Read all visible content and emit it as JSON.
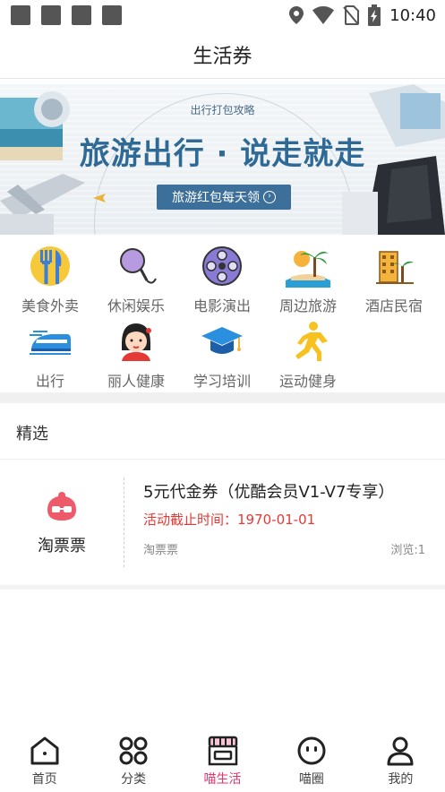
{
  "status_bar": {
    "time": "10:40",
    "icons": [
      "notification-square-icon",
      "notification-square-icon",
      "notification-square-icon",
      "notification-square-icon",
      "location-icon",
      "wifi-icon",
      "no-sim-icon",
      "battery-charging-icon"
    ]
  },
  "header": {
    "title": "生活券"
  },
  "banner": {
    "subtitle": "出行打包攻略",
    "title": "旅游出行 · 说走就走",
    "button_label": "旅游红包每天领"
  },
  "categories": [
    {
      "label": "美食外卖",
      "icon": "food-utensils-icon"
    },
    {
      "label": "休闲娱乐",
      "icon": "microphone-icon"
    },
    {
      "label": "电影演出",
      "icon": "film-reel-icon"
    },
    {
      "label": "周边旅游",
      "icon": "beach-palm-icon"
    },
    {
      "label": "酒店民宿",
      "icon": "hotel-icon"
    },
    {
      "label": "出行",
      "icon": "train-icon"
    },
    {
      "label": "丽人健康",
      "icon": "beauty-girl-icon"
    },
    {
      "label": "学习培训",
      "icon": "graduation-cap-icon"
    },
    {
      "label": "运动健身",
      "icon": "running-icon"
    }
  ],
  "featured": {
    "section_title": "精选",
    "coupon": {
      "brand": "淘票票",
      "title": "5元代金券（优酷会员V1-V7专享）",
      "deadline": "活动截止时间：1970-01-01",
      "source": "淘票票",
      "views": "浏览:1"
    }
  },
  "bottom_nav": {
    "active_index": 2,
    "accent_color": "#e8356b",
    "items": [
      {
        "label": "首页",
        "icon": "home-icon"
      },
      {
        "label": "分类",
        "icon": "category-grid-icon"
      },
      {
        "label": "喵生活",
        "icon": "store-icon"
      },
      {
        "label": "喵圈",
        "icon": "smiley-circle-icon"
      },
      {
        "label": "我的",
        "icon": "user-icon"
      }
    ]
  }
}
